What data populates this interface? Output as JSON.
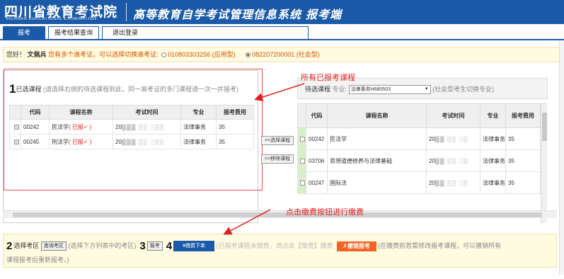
{
  "header": {
    "logo_cn": "四川省教育考试院",
    "logo_en": "SICHUAN EDUCATIONAL EXAMINATION",
    "system_title": "高等教育自学考试管理信息系统",
    "system_suffix": "报考端",
    "bg_color": "#1b5aa8"
  },
  "tabs": [
    {
      "label": "报考",
      "active": true
    },
    {
      "label": "报考结果查询",
      "active": false
    },
    {
      "label": "退出登录",
      "active": false
    }
  ],
  "hello": {
    "greeting": "您好！",
    "name": "文佩兵",
    "hint": "您有多个准考证，可以选择切换准考证:",
    "card1": "010803303256 (应用型)",
    "card2": "082207200001 (社会型)"
  },
  "selected": {
    "step": "1",
    "title": "已选课程",
    "note": "(请选择右侧的待选课程到此，同一准考证的多门课程请一次一并报考)",
    "headers": [
      "代码",
      "课程名称",
      "考试时间",
      "专业",
      "报考费用"
    ],
    "rows": [
      {
        "code": "00242",
        "name": "民法学",
        "status": "( 已报✓ )",
        "time": "20",
        "major": "法律事务",
        "fee": "35"
      },
      {
        "code": "00245",
        "name": "刑法学",
        "status": "( 已报✓ )",
        "time": "20",
        "major": "法律事务",
        "fee": "35"
      }
    ]
  },
  "middle_buttons": {
    "select": "<<选择课程",
    "remove": ">>移除课程"
  },
  "pending": {
    "label": "待选课程",
    "major_label": "专业:",
    "major_value": "法律事务H680503",
    "note": "(社会型考生切换专业)",
    "headers": [
      "代码",
      "课程名称",
      "考试时间",
      "专业",
      "报考费用"
    ],
    "rows": [
      {
        "code": "00242",
        "name": "民法学",
        "time": "20",
        "major": "法律事务",
        "fee": "35"
      },
      {
        "code": "03706",
        "name": "思想道德修养与法律基础",
        "time": "20",
        "major": "法律事务",
        "fee": "35"
      },
      {
        "code": "00247",
        "name": "国际法",
        "time": "20",
        "major": "法律事务",
        "fee": "35"
      }
    ]
  },
  "annotations": {
    "all_registered": "所有已报考课程",
    "click_pay": "点击缴费按钮进行缴费"
  },
  "bottom": {
    "step2": "2",
    "select_area_label": "选择考区",
    "query_area_btn": "查询考区",
    "area_note": "(选择下方列表中的考区)",
    "step3": "3",
    "register_btn": "报考",
    "step4": "4",
    "pay_btn": "¥缴费下单",
    "pay_note": "(已报考课程未缴费，请点击【缴费】缴费",
    "cancel_btn": "✗撤销报考",
    "cancel_note": "(在缴费前若需修改报考课程，可以撤销所有",
    "line2": "课程报考后重新报考。)"
  }
}
